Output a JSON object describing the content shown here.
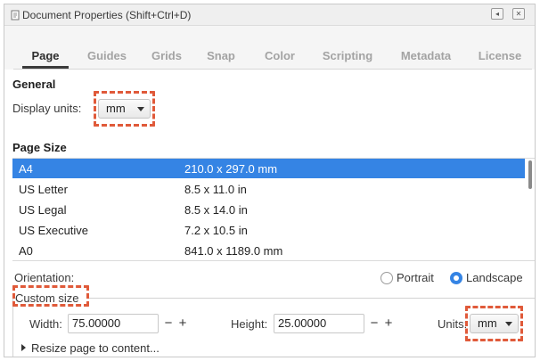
{
  "window": {
    "title": "Document Properties (Shift+Ctrl+D)",
    "buttons": {
      "minimize": "◂",
      "close": "✕"
    }
  },
  "tabs": [
    {
      "label": "Page",
      "active": true
    },
    {
      "label": "Guides",
      "active": false
    },
    {
      "label": "Grids",
      "active": false
    },
    {
      "label": "Snap",
      "active": false
    },
    {
      "label": "Color",
      "active": false
    },
    {
      "label": "Scripting",
      "active": false
    },
    {
      "label": "Metadata",
      "active": false
    },
    {
      "label": "License",
      "active": false
    }
  ],
  "general": {
    "title": "General",
    "display_units_label": "Display units:",
    "display_units_value": "mm"
  },
  "page_size": {
    "title": "Page Size",
    "rows": [
      {
        "name": "A4",
        "size": "210.0 x 297.0 mm",
        "selected": true
      },
      {
        "name": "US Letter",
        "size": "8.5 x 11.0 in",
        "selected": false
      },
      {
        "name": "US Legal",
        "size": "8.5 x 14.0 in",
        "selected": false
      },
      {
        "name": "US Executive",
        "size": "7.2 x 10.5 in",
        "selected": false
      },
      {
        "name": "A0",
        "size": "841.0 x 1189.0 mm",
        "selected": false
      }
    ]
  },
  "orientation": {
    "label": "Orientation:",
    "portrait": "Portrait",
    "landscape": "Landscape",
    "selected": "landscape"
  },
  "custom_size": {
    "title": "Custom size",
    "width_label": "Width:",
    "width_value": "75.00000",
    "height_label": "Height:",
    "height_value": "25.00000",
    "units_label": "Units:",
    "units_value": "mm",
    "minus": "−",
    "plus": "+",
    "resize_label": "Resize page to content..."
  },
  "colors": {
    "accent": "#3584e4",
    "highlight": "#e05a3a"
  }
}
